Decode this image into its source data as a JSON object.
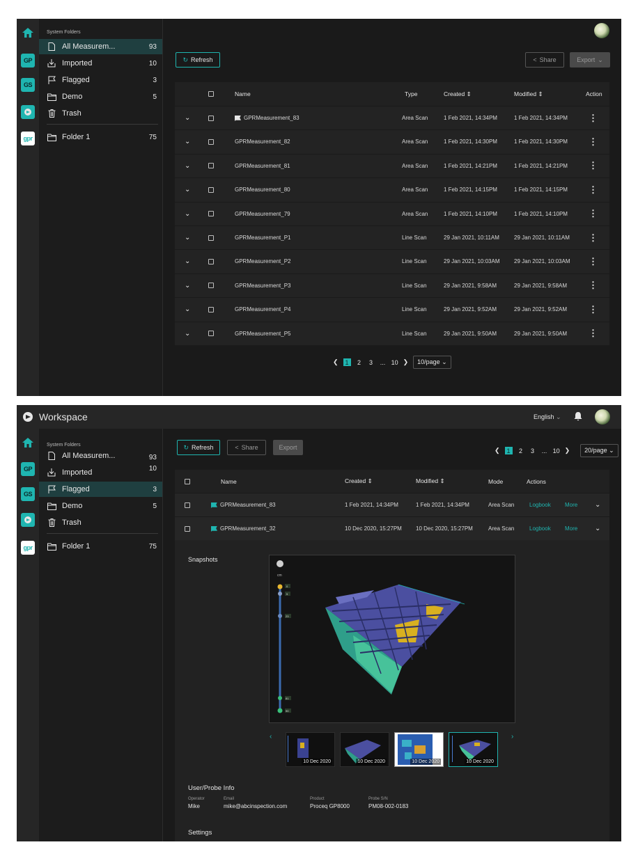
{
  "colors": {
    "accent": "#1fb5b0",
    "background": "#1a1a1a",
    "surface": "#232323"
  },
  "rail": {
    "icons": [
      "home-icon",
      "gp-app-icon",
      "gs-app-icon",
      "eagle-app-icon",
      "gpr-app-icon"
    ],
    "labels": [
      "GP",
      "GS",
      "gpr"
    ]
  },
  "sidebar": {
    "caption": "System Folders",
    "items": [
      {
        "label": "All Measurem...",
        "count": "93",
        "icon": "file-icon"
      },
      {
        "label": "Imported",
        "count": "10",
        "icon": "import-icon"
      },
      {
        "label": "Flagged",
        "count": "3",
        "icon": "flag-icon"
      },
      {
        "label": "Demo",
        "count": "5",
        "icon": "folder-icon"
      },
      {
        "label": "Trash",
        "count": "",
        "icon": "trash-icon"
      }
    ],
    "folder": {
      "label": "Folder 1",
      "count": "75"
    }
  },
  "view1": {
    "refresh": "Refresh",
    "share": "Share",
    "export": "Export",
    "columns": {
      "name": "Name",
      "type": "Type",
      "created": "Created ⇕",
      "modified": "Modified ⇕",
      "action": "Action"
    },
    "rows": [
      {
        "name": "GPRMeasurement_83",
        "type": "Area Scan",
        "created": "1 Feb 2021, 14:34PM",
        "modified": "1 Feb 2021, 14:34PM",
        "flagged": true
      },
      {
        "name": "GPRMeasurement_82",
        "type": "Area Scan",
        "created": "1 Feb 2021, 14:30PM",
        "modified": "1 Feb 2021, 14:30PM"
      },
      {
        "name": "GPRMeasurement_81",
        "type": "Area Scan",
        "created": "1 Feb 2021, 14:21PM",
        "modified": "1 Feb 2021, 14:21PM"
      },
      {
        "name": "GPRMeasurement_80",
        "type": "Area Scan",
        "created": "1 Feb 2021, 14:15PM",
        "modified": "1 Feb 2021, 14:15PM"
      },
      {
        "name": "GPRMeasurement_79",
        "type": "Area Scan",
        "created": "1 Feb 2021, 14:10PM",
        "modified": "1 Feb 2021, 14:10PM"
      },
      {
        "name": "GPRMeasurement_P1",
        "type": "Line Scan",
        "created": "29 Jan 2021, 10:11AM",
        "modified": "29 Jan 2021, 10:11AM"
      },
      {
        "name": "GPRMeasurement_P2",
        "type": "Line Scan",
        "created": "29 Jan 2021, 10:03AM",
        "modified": "29 Jan 2021, 10:03AM"
      },
      {
        "name": "GPRMeasurement_P3",
        "type": "Line Scan",
        "created": "29 Jan 2021, 9:58AM",
        "modified": "29 Jan 2021, 9:58AM"
      },
      {
        "name": "GPRMeasurement_P4",
        "type": "Line Scan",
        "created": "29 Jan 2021, 9:52AM",
        "modified": "29 Jan 2021, 9:52AM"
      },
      {
        "name": "GPRMeasurement_P5",
        "type": "Line Scan",
        "created": "29 Jan 2021, 9:50AM",
        "modified": "29 Jan 2021, 9:50AM"
      }
    ],
    "pager": {
      "pages": [
        "1",
        "2",
        "3",
        "...",
        "10"
      ],
      "current": "1",
      "page_size": "10/page"
    }
  },
  "view2": {
    "title": "Workspace",
    "language": "English",
    "refresh": "Refresh",
    "share": "Share",
    "export": "Export",
    "pager": {
      "pages": [
        "1",
        "2",
        "3",
        "...",
        "10"
      ],
      "current": "1",
      "page_size": "20/page"
    },
    "columns": {
      "name": "Name",
      "created": "Created ⇕",
      "modified": "Modified ⇕",
      "mode": "Mode",
      "actions": "Actions"
    },
    "rows": [
      {
        "name": "GPRMeasurement_83",
        "created": "1 Feb 2021, 14:34PM",
        "modified": "1 Feb 2021, 14:34PM",
        "mode": "Area Scan",
        "logbook": "Logbook",
        "more": "More"
      },
      {
        "name": "GPRMeasurement_32",
        "created": "10 Dec 2020, 15:27PM",
        "modified": "10 Dec 2020, 15:27PM",
        "mode": "Area Scan",
        "logbook": "Logbook",
        "more": "More"
      }
    ],
    "snapshots_label": "Snapshots",
    "depth_unit": "cm",
    "depth_markers": [
      "0",
      "5",
      "23",
      "81",
      "90"
    ],
    "thumb_dates": [
      "10 Dec 2020",
      "10 Dec 2020",
      "10 Dec 2020",
      "10 Dec 2020"
    ],
    "user_probe": {
      "heading": "User/Probe Info",
      "fields": [
        {
          "label": "Operator",
          "value": "Mike"
        },
        {
          "label": "Email",
          "value": "mike@abcinspection.com"
        },
        {
          "label": "Product",
          "value": "Proceq GP8000"
        },
        {
          "label": "Probe S/N",
          "value": "PM08-002-0183"
        }
      ]
    },
    "settings_heading": "Settings"
  }
}
